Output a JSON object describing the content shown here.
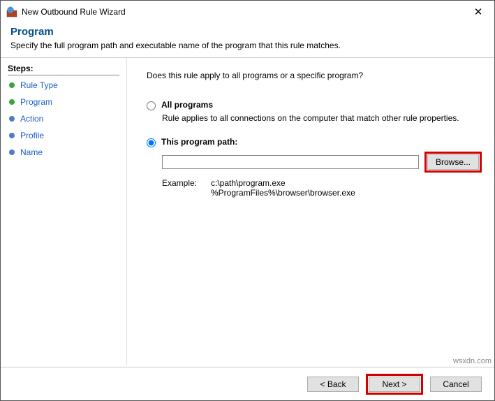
{
  "window": {
    "title": "New Outbound Rule Wizard"
  },
  "header": {
    "title": "Program",
    "subtitle": "Specify the full program path and executable name of the program that this rule matches."
  },
  "sidebar": {
    "title": "Steps:",
    "items": [
      {
        "label": "Rule Type",
        "color": "green"
      },
      {
        "label": "Program",
        "color": "green"
      },
      {
        "label": "Action",
        "color": "blue"
      },
      {
        "label": "Profile",
        "color": "blue"
      },
      {
        "label": "Name",
        "color": "blue"
      }
    ]
  },
  "content": {
    "question": "Does this rule apply to all programs or a specific program?",
    "option_all": {
      "label": "All programs",
      "desc": "Rule applies to all connections on the computer that match other rule properties."
    },
    "option_path": {
      "label": "This program path:",
      "value": "",
      "browse": "Browse...",
      "example_label": "Example:",
      "example_text": "c:\\path\\program.exe\n%ProgramFiles%\\browser\\browser.exe"
    }
  },
  "footer": {
    "back": "< Back",
    "next": "Next >",
    "cancel": "Cancel"
  },
  "watermark": "wsxdn.com"
}
